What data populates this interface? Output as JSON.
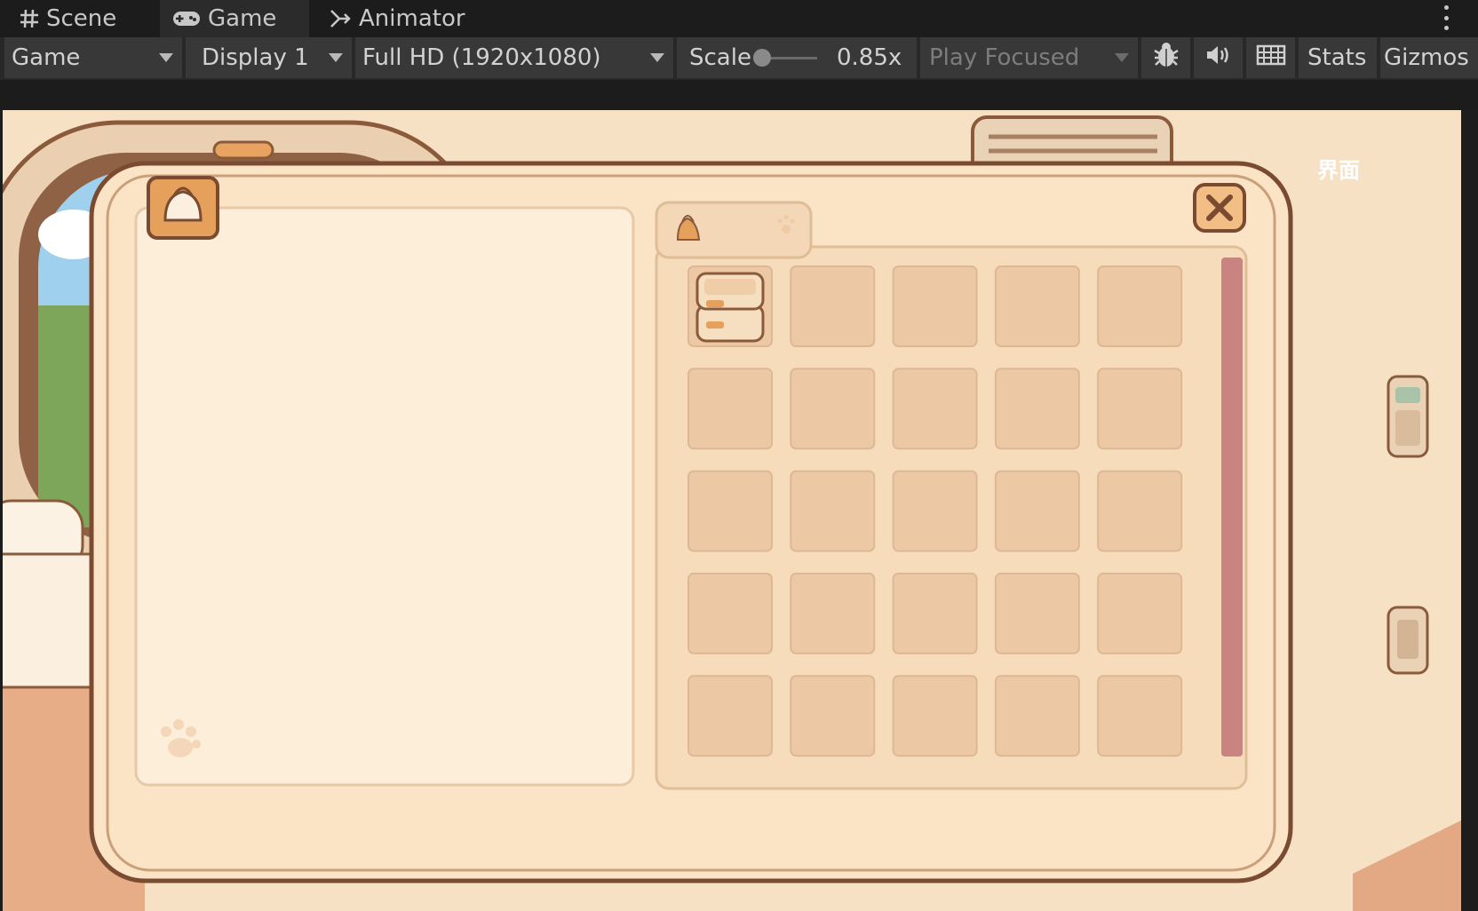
{
  "tabs": [
    {
      "label": "Scene",
      "icon": "grid-icon"
    },
    {
      "label": "Game",
      "icon": "gamepad-icon",
      "active": true
    },
    {
      "label": "Animator",
      "icon": "animator-icon"
    }
  ],
  "toolbar": {
    "mode": "Game",
    "display": "Display 1",
    "resolution": "Full HD (1920x1080)",
    "scale_label": "Scale",
    "scale_value": "0.85x",
    "play_mode": "Play Focused",
    "stats": "Stats",
    "gizmos": "Gizmos"
  },
  "game": {
    "header_text": "界面",
    "panel": {
      "tabs": [
        "bag-icon",
        "paw-icon"
      ],
      "close_icon": "close-icon",
      "badge_icon": "bag-icon",
      "detail_icon": "paw-icon"
    },
    "inventory": {
      "rows": 5,
      "cols": 5,
      "items": [
        {
          "slot": 0,
          "name": "storage-box"
        }
      ]
    }
  },
  "colors": {
    "editor_bg": "#1c1c1c",
    "toolbar_button": "#383838",
    "panel_cream": "#fbe5c8",
    "panel_border": "#7a4a31",
    "slot_fill": "#ecc9a4",
    "scrollbar": "#c98380",
    "accent_orange": "#e4a15c"
  }
}
